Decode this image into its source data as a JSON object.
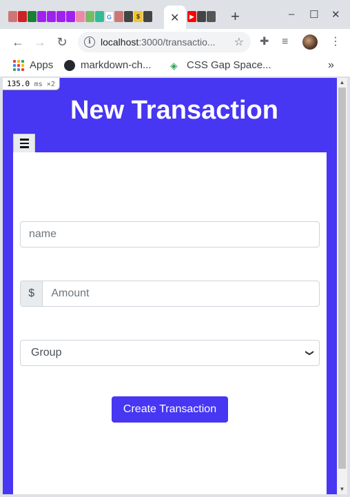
{
  "browser": {
    "active_tab_close": "✕",
    "new_tab": "+",
    "window_controls": {
      "minimize": "–",
      "maximize": "☐",
      "close": "✕"
    },
    "url_host": "localhost",
    "url_rest": ":3000/transactio...",
    "omnibox_info": "i"
  },
  "bookmarks": {
    "items": [
      {
        "label": "Apps",
        "icon": "apps-grid-icon"
      },
      {
        "label": "markdown-ch...",
        "icon": "github-icon"
      },
      {
        "label": "CSS Gap Space...",
        "icon": "css-gap-icon"
      }
    ],
    "more": "»"
  },
  "devtools": {
    "fps": "135.0",
    "unit": "ms ×2"
  },
  "page": {
    "title": "New Transaction",
    "name_placeholder": "name",
    "currency_symbol": "$",
    "amount_placeholder": "Amount",
    "group_selected": "Group",
    "submit_label": "Create Transaction"
  },
  "colors": {
    "brand": "#4736f2",
    "panel": "#ffffff",
    "tabstrip": "#dee1e6"
  }
}
